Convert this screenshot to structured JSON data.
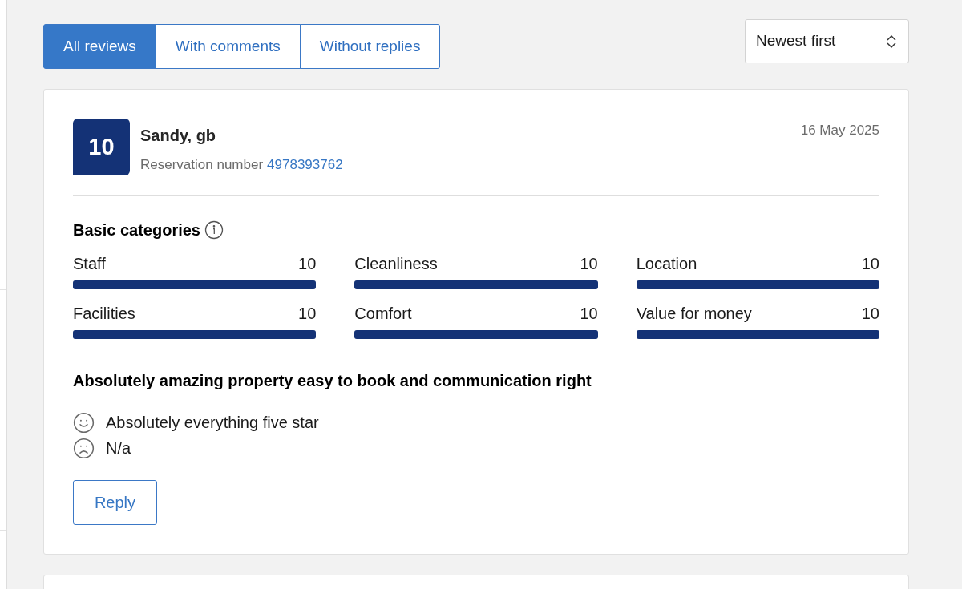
{
  "tabs": [
    {
      "label": "All reviews",
      "selected": true
    },
    {
      "label": "With comments",
      "selected": false
    },
    {
      "label": "Without replies",
      "selected": false
    }
  ],
  "sort": {
    "value": "Newest first"
  },
  "review": {
    "score": "10",
    "name": "Sandy, gb",
    "reservation_label": "Reservation number",
    "reservation_number": "4978393762",
    "date": "16 May 2025",
    "categories_title": "Basic categories",
    "categories": [
      {
        "label": "Staff",
        "score": "10",
        "level": 1
      },
      {
        "label": "Cleanliness",
        "score": "10",
        "level": 1
      },
      {
        "label": "Location",
        "score": "10",
        "level": 1
      },
      {
        "label": "Facilities",
        "score": "10",
        "level": 1
      },
      {
        "label": "Comfort",
        "score": "10",
        "level": 1
      },
      {
        "label": "Value for money",
        "score": "10",
        "level": 1
      }
    ],
    "title": "Absolutely amazing property easy to book and communication right",
    "comments": [
      {
        "kind": "positive",
        "text": "Absolutely everything five star"
      },
      {
        "kind": "negative",
        "text": "N/a"
      }
    ],
    "reply_button": "Reply"
  }
}
